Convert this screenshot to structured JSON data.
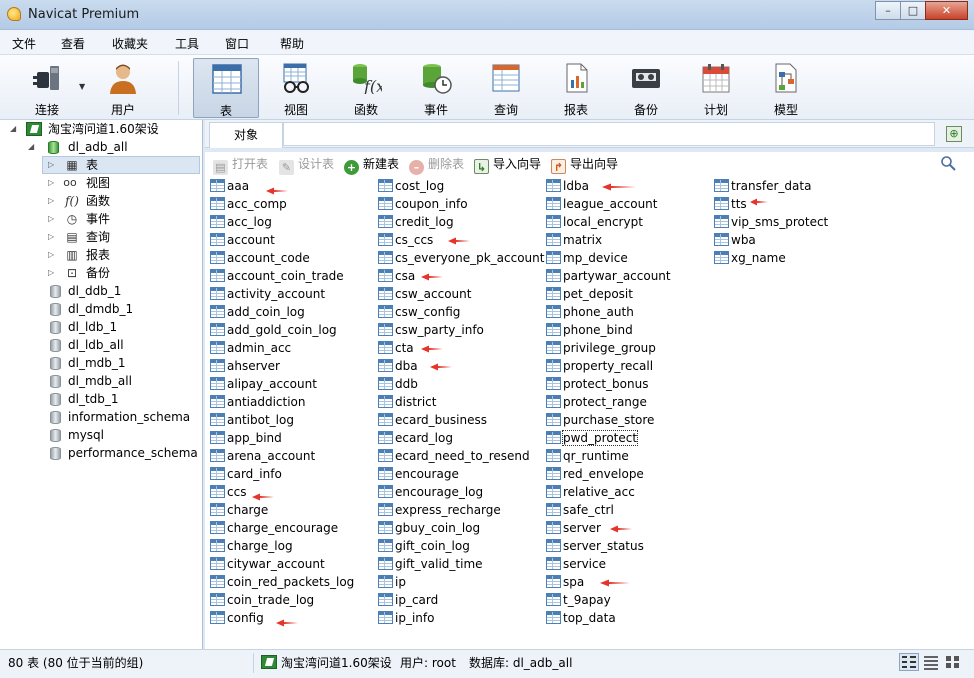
{
  "window": {
    "title": "Navicat Premium"
  },
  "menu": [
    "文件",
    "查看",
    "收藏夹",
    "工具",
    "窗口",
    "帮助"
  ],
  "toolbar": [
    {
      "label": "连接",
      "icon": "plug-icon"
    },
    {
      "label": "用户",
      "icon": "user-icon"
    },
    {
      "label": "表",
      "icon": "table-icon",
      "active": true
    },
    {
      "label": "视图",
      "icon": "view-glasses-icon"
    },
    {
      "label": "函数",
      "icon": "function-icon"
    },
    {
      "label": "事件",
      "icon": "event-clock-icon"
    },
    {
      "label": "查询",
      "icon": "query-icon"
    },
    {
      "label": "报表",
      "icon": "report-icon"
    },
    {
      "label": "备份",
      "icon": "backup-tape-icon"
    },
    {
      "label": "计划",
      "icon": "schedule-calendar-icon"
    },
    {
      "label": "模型",
      "icon": "model-icon"
    }
  ],
  "tree": {
    "connection": "淘宝湾问道1.60架设",
    "active_db": "dl_adb_all",
    "categories": [
      "表",
      "视图",
      "函数",
      "事件",
      "查询",
      "报表",
      "备份"
    ],
    "databases": [
      "dl_ddb_1",
      "dl_dmdb_1",
      "dl_ldb_1",
      "dl_ldb_all",
      "dl_mdb_1",
      "dl_mdb_all",
      "dl_tdb_1",
      "information_schema",
      "mysql",
      "performance_schema"
    ]
  },
  "tab": {
    "label": "对象"
  },
  "object_toolbar": {
    "open": "打开表",
    "design": "设计表",
    "new": "新建表",
    "delete": "删除表",
    "import": "导入向导",
    "export": "导出向导"
  },
  "tables": [
    [
      "aaa",
      "acc_comp",
      "acc_log",
      "account",
      "account_code",
      "account_coin_trade",
      "activity_account",
      "add_coin_log",
      "add_gold_coin_log",
      "admin_acc",
      "ahserver",
      "alipay_account",
      "antiaddiction",
      "antibot_log",
      "app_bind",
      "arena_account",
      "card_info",
      "ccs",
      "charge",
      "charge_encourage",
      "charge_log",
      "citywar_account",
      "coin_red_packets_log",
      "coin_trade_log",
      "config"
    ],
    [
      "cost_log",
      "coupon_info",
      "credit_log",
      "cs_ccs",
      "cs_everyone_pk_account",
      "csa",
      "csw_account",
      "csw_config",
      "csw_party_info",
      "cta",
      "dba",
      "ddb",
      "district",
      "ecard_business",
      "ecard_log",
      "ecard_need_to_resend",
      "encourage",
      "encourage_log",
      "express_recharge",
      "gbuy_coin_log",
      "gift_coin_log",
      "gift_valid_time",
      "ip",
      "ip_card",
      "ip_info"
    ],
    [
      "ldba",
      "league_account",
      "local_encrypt",
      "matrix",
      "mp_device",
      "partywar_account",
      "pet_deposit",
      "phone_auth",
      "phone_bind",
      "privilege_group",
      "property_recall",
      "protect_bonus",
      "protect_range",
      "purchase_store",
      "pwd_protect",
      "qr_runtime",
      "red_envelope",
      "relative_acc",
      "safe_ctrl",
      "server",
      "server_status",
      "service",
      "spa",
      "t_9apay",
      "top_data"
    ],
    [
      "transfer_data",
      "tts",
      "vip_sms_protect",
      "wba",
      "xg_name"
    ]
  ],
  "status": {
    "count": "80 表 (80 位于当前的组)",
    "connection": "淘宝湾问道1.60架设",
    "user": "用户: root",
    "database": "数据库: dl_adb_all"
  }
}
